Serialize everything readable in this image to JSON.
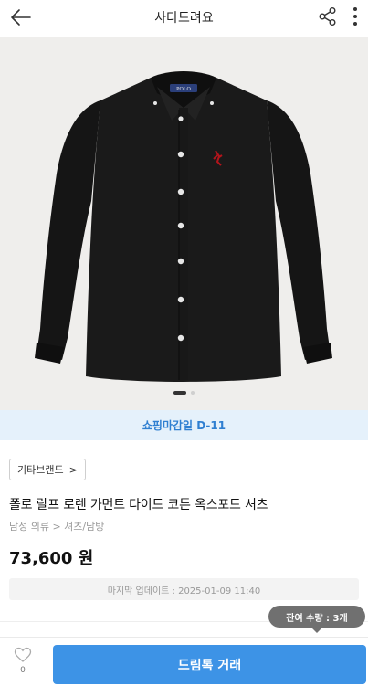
{
  "header": {
    "title": "사다드려요",
    "back_icon": "arrow-left-icon",
    "share_icon": "share-icon",
    "more_icon": "more-vertical-icon"
  },
  "gallery": {
    "image": "black-oxford-shirt",
    "page_count": 2,
    "current_page": 1
  },
  "banner": {
    "deadline_text": "쇼핑마감일 D-11"
  },
  "product": {
    "brand_tag": "기타브랜드",
    "brand_chevron": ">",
    "name": "폴로 랄프 로렌 가먼트 다이드 코튼 옥스포드 셔츠",
    "category": "남성 의류 > 셔츠/남방",
    "price": "73,600 원",
    "last_update": "마지막 업데이트 : 2025-01-09 11:40"
  },
  "stock": {
    "label": "잔여 수량 : 3개"
  },
  "bottom_bar": {
    "like_count": "0",
    "buy_label": "드림톡 거래"
  },
  "colors": {
    "accent": "#3d93e6",
    "banner_bg": "#e5f1fb",
    "banner_text": "#2f7fd1"
  }
}
